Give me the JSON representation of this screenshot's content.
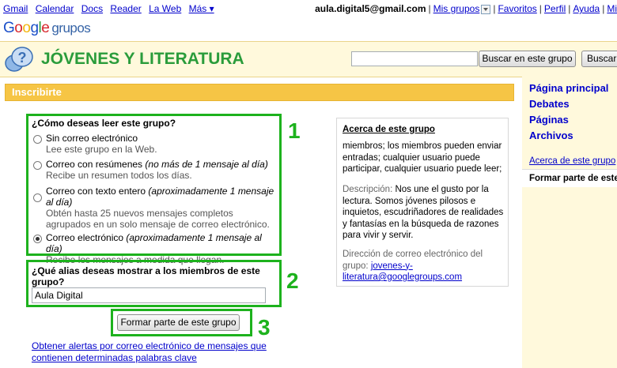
{
  "topnav": [
    "Gmail",
    "Calendar",
    "Docs",
    "Reader",
    "La Web",
    "Más ▾"
  ],
  "account": {
    "email": "aula.digital5@gmail.com",
    "links": [
      "Mis grupos",
      "Favoritos",
      "Perfil",
      "Ayuda",
      "Mi"
    ]
  },
  "logo": {
    "google": "Google",
    "grupos": "grupos"
  },
  "header": {
    "group_title": "JÓVENES Y LITERATURA",
    "search_value": "",
    "search_group_btn": "Buscar en este grupo",
    "search_all_btn": "Buscar"
  },
  "section": {
    "title": "Inscribirte"
  },
  "steps": [
    "1",
    "2",
    "3"
  ],
  "reading": {
    "question": "¿Cómo deseas leer este grupo?",
    "options": [
      {
        "label": "Sin correo electrónico",
        "note": "",
        "desc": "Lee este grupo en la Web.",
        "selected": false
      },
      {
        "label": "Correo con resúmenes",
        "note": "(no más de 1 mensaje al día)",
        "desc": "Recibe un resumen todos los días.",
        "selected": false
      },
      {
        "label": "Correo con texto entero",
        "note": "(aproximadamente 1 mensaje al día)",
        "desc": "Obtén hasta 25 nuevos mensajes completos agrupados en un solo mensaje de correo electrónico.",
        "selected": false
      },
      {
        "label": "Correo electrónico",
        "note": "(aproximadamente 1 mensaje al día)",
        "desc": "Recibe los mensajes a medida que llegan.",
        "selected": true
      }
    ]
  },
  "alias": {
    "question": "¿Qué alias deseas mostrar a los miembros de este grupo?",
    "value": "Aula Digital"
  },
  "join_button": "Formar parte de este grupo",
  "alert_link": "Obtener alertas por correo electrónico de mensajes que contienen determinadas palabras clave",
  "about": {
    "title": "Acerca de este grupo",
    "access": "miembros; los miembros pueden enviar entradas; cualquier usuario puede participar, cualquier usuario puede leer;",
    "desc_label": "Descripción:",
    "desc": "Nos une el gusto por la lectura. Somos jóvenes pilosos e inquietos, escudriñadores de realidades y fantasías en la búsqueda de razones para vivir y servir.",
    "email_label": "Dirección de correo electrónico del grupo:",
    "email": "jovenes-y-literatura@googlegroups.com"
  },
  "sidebar": {
    "links": [
      "Página principal",
      "Debates",
      "Páginas",
      "Archivos"
    ],
    "about_link": "Acerca de este grupo",
    "join_label": "Formar parte de este grupo"
  },
  "colors": {
    "green_step": "#1db21d",
    "section_orange": "#f6c545",
    "title_green": "#2a9c3b",
    "band_bg": "#fff9dc"
  }
}
